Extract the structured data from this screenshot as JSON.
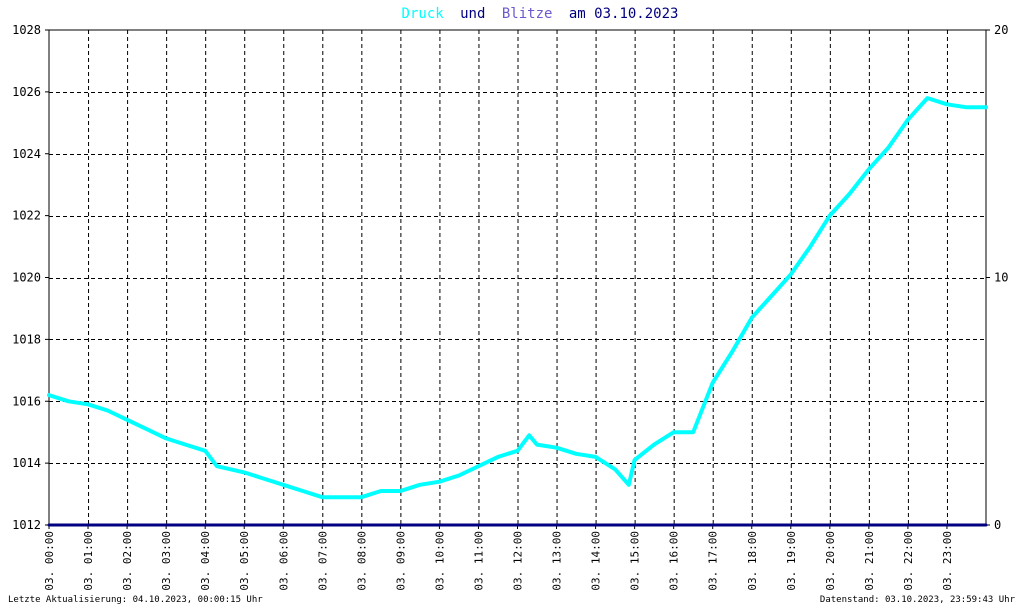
{
  "chart_data": {
    "type": "line",
    "title": {
      "series1_word": "Druck",
      "connector": "und",
      "series2_word": "Blitze",
      "date_part": "am 03.10.2023"
    },
    "x_tick_labels": [
      "03. 00:00",
      "03. 01:00",
      "03. 02:00",
      "03. 03:00",
      "03. 04:00",
      "03. 05:00",
      "03. 06:00",
      "03. 07:00",
      "03. 08:00",
      "03. 09:00",
      "03. 10:00",
      "03. 11:00",
      "03. 12:00",
      "03. 13:00",
      "03. 14:00",
      "03. 15:00",
      "03. 16:00",
      "03. 17:00",
      "03. 18:00",
      "03. 19:00",
      "03. 20:00",
      "03. 21:00",
      "03. 22:00",
      "03. 23:00"
    ],
    "xlim": [
      0,
      24
    ],
    "ylim_left": [
      1012,
      1028
    ],
    "y_ticks_left": [
      1012,
      1014,
      1016,
      1018,
      1020,
      1022,
      1024,
      1026,
      1028
    ],
    "ylim_right": [
      0,
      20
    ],
    "y_ticks_right": [
      0,
      10,
      20
    ],
    "grid": true,
    "series": [
      {
        "name": "Druck",
        "axis": "left",
        "color": "#00ffff",
        "x": [
          0,
          0.5,
          1,
          1.5,
          2,
          2.5,
          3,
          3.5,
          4,
          4.3,
          5,
          5.5,
          6,
          6.5,
          7,
          7.5,
          8,
          8.5,
          9,
          9.5,
          10,
          10.5,
          11,
          11.5,
          12,
          12.3,
          12.5,
          13,
          13.5,
          14,
          14.5,
          14.85,
          15,
          15.5,
          16,
          16.5,
          17,
          17.5,
          18,
          18.5,
          19,
          19.5,
          20,
          20.5,
          21,
          21.5,
          22,
          22.5,
          23,
          23.5,
          24
        ],
        "y": [
          1016.2,
          1016.0,
          1015.9,
          1015.7,
          1015.4,
          1015.1,
          1014.8,
          1014.6,
          1014.4,
          1013.9,
          1013.7,
          1013.5,
          1013.3,
          1013.1,
          1012.9,
          1012.9,
          1012.9,
          1013.1,
          1013.1,
          1013.3,
          1013.4,
          1013.6,
          1013.9,
          1014.2,
          1014.4,
          1014.9,
          1014.6,
          1014.5,
          1014.3,
          1014.2,
          1013.8,
          1013.3,
          1014.1,
          1014.6,
          1015.0,
          1015.0,
          1016.6,
          1017.6,
          1018.7,
          1019.4,
          1020.1,
          1021.0,
          1022.0,
          1022.7,
          1023.5,
          1024.2,
          1025.1,
          1025.8,
          1025.6,
          1025.5,
          1025.5
        ]
      },
      {
        "name": "Blitze",
        "axis": "right",
        "color": "#000080",
        "x": [
          0,
          24
        ],
        "y": [
          0,
          0
        ]
      }
    ]
  },
  "footer": {
    "left": "Letzte Aktualisierung: 04.10.2023, 00:00:15 Uhr",
    "right": "Datenstand: 03.10.2023, 23:59:43 Uhr"
  },
  "colors": {
    "druck": "#00ffff",
    "blitze": "#000080",
    "text": "#000000",
    "grid": "#000000",
    "title_other": "#00007f"
  }
}
